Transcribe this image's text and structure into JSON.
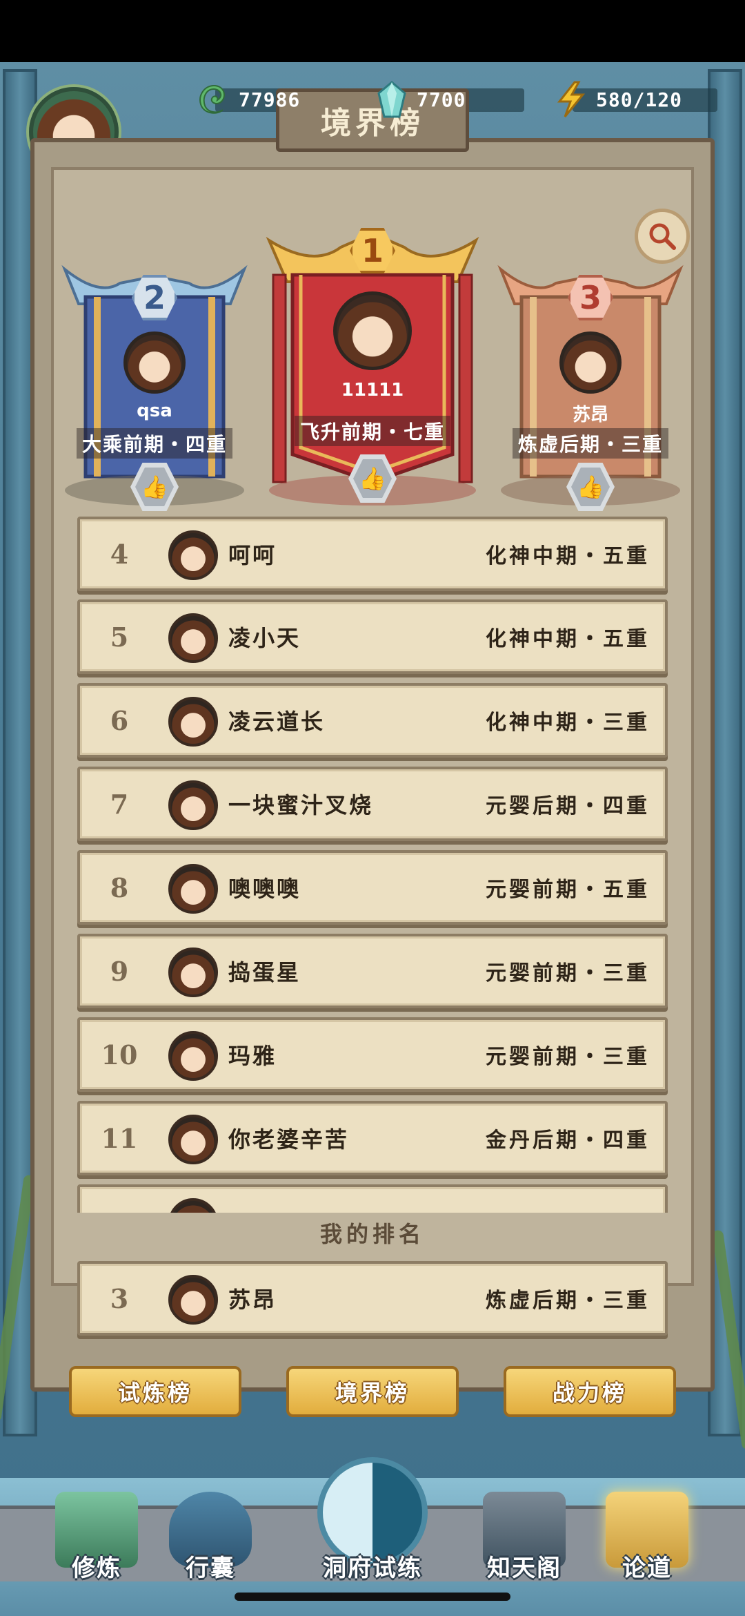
{
  "resources": {
    "jade": {
      "icon": "jade-icon",
      "value": "77986"
    },
    "crystal": {
      "icon": "crystal-icon",
      "value": "7700"
    },
    "energy": {
      "icon": "lightning-icon",
      "value": "580/120"
    }
  },
  "title": "境界榜",
  "podium": [
    {
      "rank": "1",
      "name": "11111",
      "realm": "飞升前期・七重"
    },
    {
      "rank": "2",
      "name": "qsa",
      "realm": "大乘前期・四重"
    },
    {
      "rank": "3",
      "name": "苏昂",
      "realm": "炼虚后期・三重"
    }
  ],
  "list": [
    {
      "rank": "4",
      "name": "呵呵",
      "realm": "化神中期・五重"
    },
    {
      "rank": "5",
      "name": "凌小天",
      "realm": "化神中期・五重"
    },
    {
      "rank": "6",
      "name": "凌云道长",
      "realm": "化神中期・三重"
    },
    {
      "rank": "7",
      "name": "一块蜜汁叉烧",
      "realm": "元婴后期・四重"
    },
    {
      "rank": "8",
      "name": "噢噢噢",
      "realm": "元婴前期・五重"
    },
    {
      "rank": "9",
      "name": "捣蛋星",
      "realm": "元婴前期・三重"
    },
    {
      "rank": "10",
      "name": "玛雅",
      "realm": "元婴前期・三重"
    },
    {
      "rank": "11",
      "name": "你老婆辛苦",
      "realm": "金丹后期・四重"
    }
  ],
  "my_rank": {
    "label": "我的排名",
    "rank": "3",
    "name": "苏昂",
    "realm": "炼虚后期・三重"
  },
  "tabs": [
    "试炼榜",
    "境界榜",
    "战力榜"
  ],
  "nav": [
    "修炼",
    "行囊",
    "洞府试练",
    "知天阁",
    "论道"
  ],
  "colors": {
    "row_bg": "#ece0c2",
    "tab_gold": "#f6d67a",
    "board": "#bfb49d"
  }
}
